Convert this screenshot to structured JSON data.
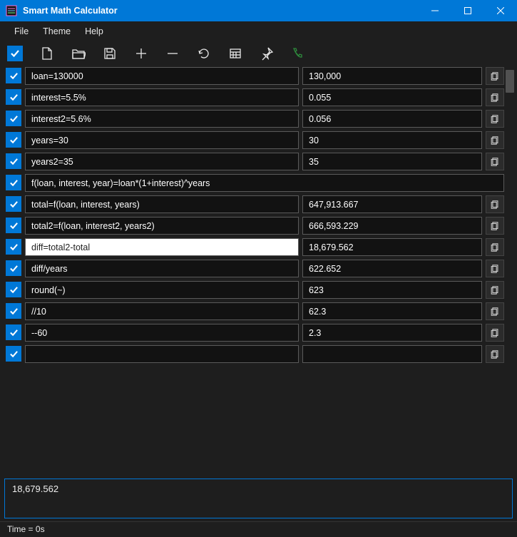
{
  "window": {
    "title": "Smart Math Calculator"
  },
  "menu": {
    "file": "File",
    "theme": "Theme",
    "help": "Help"
  },
  "rows": [
    {
      "expr": "loan=130000",
      "result": "130,000",
      "fullwidth": false,
      "active": false
    },
    {
      "expr": "interest=5.5%",
      "result": "0.055",
      "fullwidth": false,
      "active": false
    },
    {
      "expr": "interest2=5.6%",
      "result": "0.056",
      "fullwidth": false,
      "active": false
    },
    {
      "expr": "years=30",
      "result": "30",
      "fullwidth": false,
      "active": false
    },
    {
      "expr": "years2=35",
      "result": "35",
      "fullwidth": false,
      "active": false
    },
    {
      "expr": "f(loan, interest, year)=loan*(1+interest)^years",
      "result": "",
      "fullwidth": true,
      "active": false
    },
    {
      "expr": "total=f(loan, interest, years)",
      "result": "647,913.667",
      "fullwidth": false,
      "active": false
    },
    {
      "expr": "total2=f(loan, interest2, years2)",
      "result": "666,593.229",
      "fullwidth": false,
      "active": false
    },
    {
      "expr": "diff=total2-total",
      "result": "18,679.562",
      "fullwidth": false,
      "active": true
    },
    {
      "expr": "diff/years",
      "result": "622.652",
      "fullwidth": false,
      "active": false
    },
    {
      "expr": "round(~)",
      "result": "623",
      "fullwidth": false,
      "active": false
    },
    {
      "expr": "//10",
      "result": "62.3",
      "fullwidth": false,
      "active": false
    },
    {
      "expr": "--60",
      "result": "2.3",
      "fullwidth": false,
      "active": false
    },
    {
      "expr": "",
      "result": "",
      "fullwidth": false,
      "active": false
    }
  ],
  "bigresult": "18,679.562",
  "status": "Time = 0s"
}
